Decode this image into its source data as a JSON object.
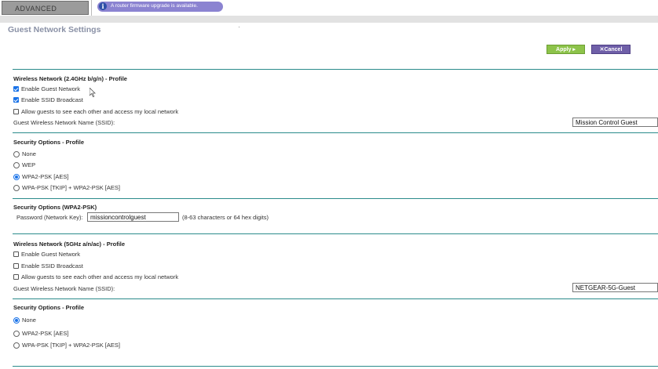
{
  "header": {
    "tab_label": "ADVANCED",
    "notice_icon": "i",
    "notice": "A router firmware upgrade is available."
  },
  "page_title": "Guest Network Settings",
  "buttons": {
    "apply": "Apply ▸",
    "cancel": "✕Cancel"
  },
  "wireless_24": {
    "heading": "Wireless Network (2.4GHz b/g/n) - Profile",
    "enable_guest": "Enable Guest Network",
    "enable_ssid": "Enable SSID Broadcast",
    "allow_guests": "Allow guests to see each other and access my local network",
    "ssid_label": "Guest Wireless Network Name (SSID):",
    "ssid_value": "Mission Control Guest",
    "enable_guest_checked": true,
    "enable_ssid_checked": true,
    "allow_guests_checked": false
  },
  "security_24": {
    "heading": "Security Options - Profile",
    "options": [
      "None",
      "WEP",
      "WPA2-PSK [AES]",
      "WPA-PSK [TKIP] + WPA2-PSK [AES]"
    ],
    "selected": "WPA2-PSK [AES]"
  },
  "wpa2": {
    "heading": "Security Options (WPA2-PSK)",
    "password_label": "Password (Network Key):",
    "password_value": "missioncontrolguest",
    "hint": "(8-63 characters or 64 hex digits)"
  },
  "wireless_5": {
    "heading": "Wireless Network (5GHz a/n/ac) - Profile",
    "enable_guest": "Enable Guest Network",
    "enable_ssid": "Enable SSID Broadcast",
    "allow_guests": "Allow guests to see each other and access my local network",
    "ssid_label": "Guest Wireless Network Name (SSID):",
    "ssid_value": "NETGEAR-5G-Guest",
    "enable_guest_checked": false,
    "enable_ssid_checked": false,
    "allow_guests_checked": false
  },
  "security_5": {
    "heading": "Security Options - Profile",
    "options": [
      "None",
      "WPA2-PSK [AES]",
      "WPA-PSK [TKIP] + WPA2-PSK [AES]"
    ],
    "selected": "None"
  },
  "colors": {
    "accent_rule": "#2b8b8b",
    "apply_button": "#8dc34a",
    "cancel_button": "#6f5fa8",
    "notice_bg": "#8b83d1",
    "title": "#8a91a6"
  }
}
